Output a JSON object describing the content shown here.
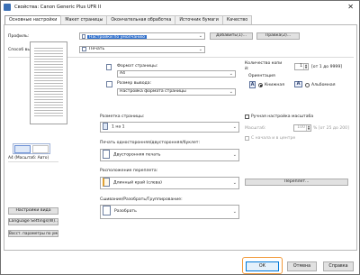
{
  "window": {
    "title": "Свойства: Canon Generic Plus UFR II",
    "close_glyph": "✕"
  },
  "tabs": [
    {
      "label": "Основные настройки",
      "active": true
    },
    {
      "label": "Макет страницы",
      "active": false
    },
    {
      "label": "Окончательная обработка",
      "active": false
    },
    {
      "label": "Источник бумаги",
      "active": false
    },
    {
      "label": "Качество",
      "active": false
    }
  ],
  "profile": {
    "label": "Профиль:",
    "value": "Настройки по умолчанию",
    "add_button": "Добавить(1)...",
    "edit_button": "Правка(2)..."
  },
  "output_method": {
    "label": "Способ вывода:",
    "value": "Печать"
  },
  "preview": {
    "caption": "A4 (Масштаб: Авто)",
    "settings_button": "Настройки вида",
    "language_button": "Language Settings(W)...",
    "restore_button": "Восст. параметры по умолчанию"
  },
  "page_size": {
    "label": "Формат страницы:",
    "value": "A4"
  },
  "output_size": {
    "label": "Размер вывода:",
    "value": "Настройка формата страницы"
  },
  "copies": {
    "label": "Количество копи",
    "label2": "й:",
    "value": "1",
    "range": "[от 1 до 9999]"
  },
  "orientation": {
    "label": "Ориентация",
    "portrait": "Книжная",
    "landscape": "Альбомная",
    "selected": "portrait",
    "portrait_glyph": "A",
    "landscape_glyph": "A"
  },
  "page_layout": {
    "label": "Разметка страницы:",
    "value": "1 на 1"
  },
  "manual_scale": {
    "label": "Ручная настройка масштаба",
    "scale_label": "Масштаб:",
    "scale_value": "100",
    "scale_range": "% [от 25 до 200]",
    "center_label": "С начала и в центре"
  },
  "duplex": {
    "label": "Печать односторонняя/двусторонняя/буклет:",
    "value": "Двусторонняя печать"
  },
  "binding": {
    "label": "Расположение переплета:",
    "value": "Длинный край (слева)",
    "gutter_button": "Переплет..."
  },
  "collate": {
    "label": "Сшивание/Разобрать/Группирование:",
    "value": "Разобрать"
  },
  "footer": {
    "ok": "ОК",
    "cancel": "Отмена",
    "help": "Справка"
  },
  "colors": {
    "accent": "#2f6fcc",
    "highlight": "#f29a3a"
  }
}
